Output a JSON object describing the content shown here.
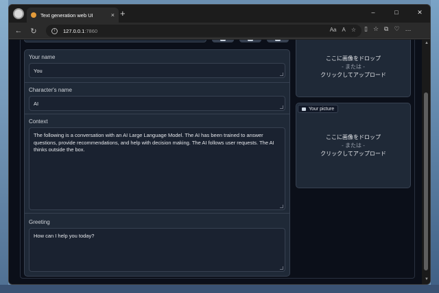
{
  "browser": {
    "tab_title": "Text generation web UI",
    "tab_close": "×",
    "new_tab": "+",
    "window_controls": {
      "minimize": "–",
      "maximize": "□",
      "close": "✕"
    },
    "nav": {
      "back": "←",
      "reload": "↻"
    },
    "url_host": "127.0.0.1",
    "url_port": ":7860",
    "info": "i",
    "address_icons": [
      "Aa",
      "A",
      "☆"
    ],
    "toolbar_icons": [
      "▯",
      "☆",
      "⧉",
      "♡",
      "…"
    ]
  },
  "form": {
    "your_name": {
      "label": "Your name",
      "value": "You"
    },
    "character_name": {
      "label": "Character's name",
      "value": "AI"
    },
    "context": {
      "label": "Context",
      "value": "The following is a conversation with an AI Large Language Model. The AI has been trained to answer questions, provide recommendations, and help with decision making. The AI follows user requests. The AI thinks outside the box."
    },
    "greeting": {
      "label": "Greeting",
      "value": "How can I help you today?"
    }
  },
  "side": {
    "character_picture": {
      "drop_line": "ここに画像をドロップ",
      "or_line": "- または -",
      "upload_line": "クリックしてアップロード"
    },
    "your_picture": {
      "label": "Your picture",
      "drop_line": "ここに画像をドロップ",
      "or_line": "- または -",
      "upload_line": "クリックしてアップロード"
    }
  },
  "scrollbar": {
    "up": "▲",
    "down": "▼"
  }
}
